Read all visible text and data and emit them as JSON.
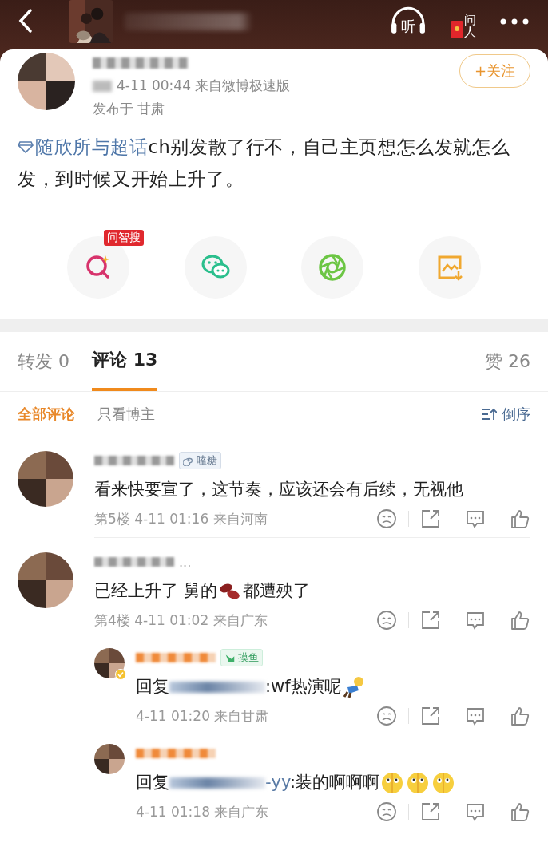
{
  "header": {
    "listen_label": "听",
    "ask_label": "问人"
  },
  "post": {
    "meta": "4-11 00:44 来自微博极速版",
    "location": "发布于 甘肃",
    "follow_button": "+关注",
    "topic": "随欣所与超话",
    "text": "ch别发散了行不，自己主页想怎么发就怎么发，到时候又开始上升了。"
  },
  "share_actions": [
    {
      "kind": "ai_search",
      "badge": "问智搜"
    },
    {
      "kind": "wechat"
    },
    {
      "kind": "moments"
    },
    {
      "kind": "save_image"
    }
  ],
  "tabs": [
    {
      "label": "转发 0",
      "selected": false
    },
    {
      "label": "评论 13",
      "selected": true
    }
  ],
  "likes_tab": "赞 26",
  "filters": [
    {
      "label": "全部评论",
      "selected": true
    },
    {
      "label": "只看博主",
      "selected": false
    }
  ],
  "sort_label": "倒序",
  "comments": [
    {
      "kind": "comment",
      "badge": {
        "kind": "spiral",
        "label": "嗑糖"
      },
      "segments": [
        {
          "kind": "text",
          "text": "看来快要宣了，这节奏，应该还会有后续，无视他"
        }
      ],
      "meta": "第5楼 4-11 01:16 来自河南"
    },
    {
      "kind": "comment",
      "name_suffix": "...",
      "segments": [
        {
          "kind": "text",
          "text": "已经上升了 舅的"
        },
        {
          "kind": "bean"
        },
        {
          "kind": "text",
          "text": "都遭殃了"
        }
      ],
      "meta": "第4楼 4-11 01:02 来自广东"
    },
    {
      "kind": "reply",
      "verified": true,
      "badge": {
        "kind": "fish",
        "label": "摸鱼"
      },
      "reply_prefix": "回复",
      "segments": [
        {
          "kind": "text",
          "text": ":wf热演呢"
        },
        {
          "kind": "figure"
        }
      ],
      "meta": "4-11 01:20 来自甘肃"
    },
    {
      "kind": "reply",
      "reply_prefix": "回复",
      "mention_tail": "-yy",
      "segments": [
        {
          "kind": "text",
          "text": ":装的啊啊啊"
        },
        {
          "kind": "face"
        },
        {
          "kind": "face"
        },
        {
          "kind": "face"
        }
      ],
      "meta": "4-11 01:18 来自广东"
    }
  ]
}
